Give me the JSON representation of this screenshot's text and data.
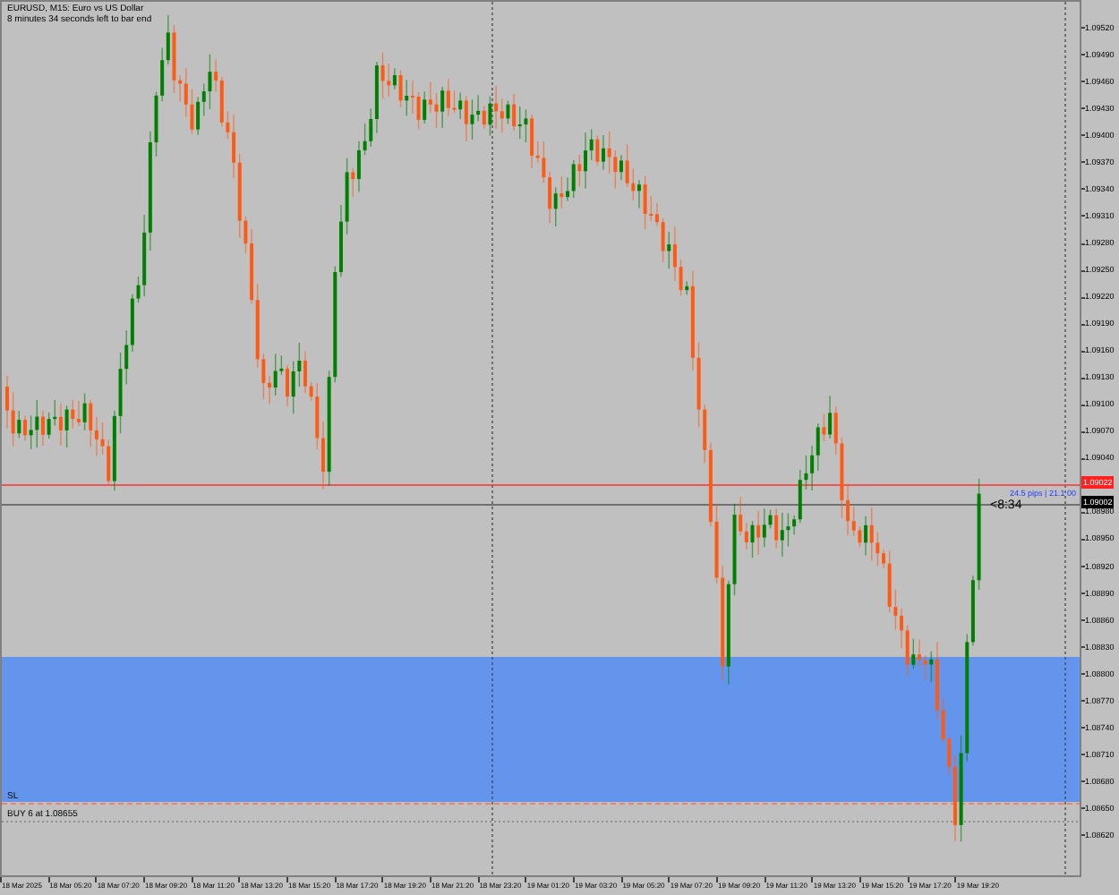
{
  "chart": {
    "symbol_line": "EURUSD, M15:  Euro vs US Dollar",
    "countdown_line": "8 minutes 34 seconds left to bar end",
    "bar_timer": "<8:34",
    "pips_label": "24.5 pips | 21.1 00",
    "ask_price": "1.09022",
    "bid_price": "1.09002",
    "stop_loss_label": "SL",
    "order_label": "BUY 6 at 1.08655",
    "price_ticks_upper": [
      "1.09520",
      "1.09490",
      "1.09460",
      "1.09430",
      "1.09400",
      "1.09370",
      "1.09340",
      "1.09310",
      "1.09280",
      "1.09250",
      "1.09220",
      "1.09190",
      "1.09160",
      "1.09130",
      "1.09100",
      "1.09070",
      "1.09040"
    ],
    "price_ticks_lower": [
      "1.08980",
      "1.08950",
      "1.08920",
      "1.08890",
      "1.08860",
      "1.08830",
      "1.08800",
      "1.08770",
      "1.08740",
      "1.08710",
      "1.08680",
      "1.08650",
      "1.08620"
    ],
    "time_labels": [
      "18 Mar 2025",
      "18 Mar 05:20",
      "18 Mar 07:20",
      "18 Mar 09:20",
      "18 Mar 11:20",
      "18 Mar 13:20",
      "18 Mar 15:20",
      "18 Mar 17:20",
      "18 Mar 19:20",
      "18 Mar 21:20",
      "18 Mar 23:20",
      "19 Mar 01:20",
      "19 Mar 03:20",
      "19 Mar 05:20",
      "19 Mar 07:20",
      "19 Mar 09:20",
      "19 Mar 11:20",
      "19 Mar 13:20",
      "19 Mar 15:20",
      "19 Mar 17:20",
      "19 Mar 19:20"
    ]
  }
}
